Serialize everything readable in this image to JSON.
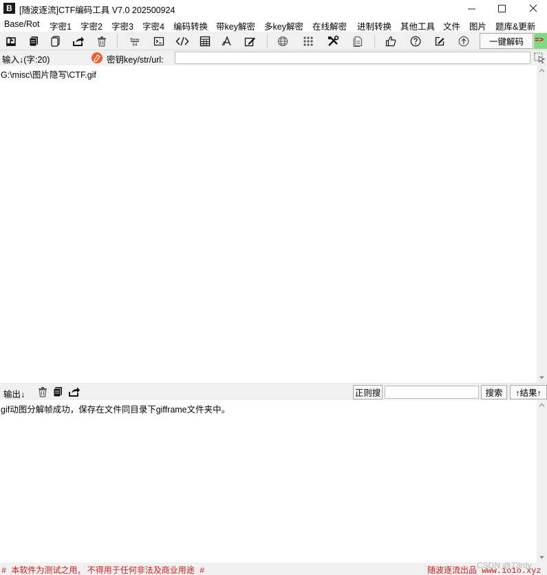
{
  "window": {
    "icon_text": "B",
    "title": "[随波逐流]CTF编码工具 V7.0  202500924"
  },
  "menu": [
    "Base/Rot",
    "字密1",
    "字密2",
    "字密3",
    "字密4",
    "编码转换",
    "带key解密",
    "多key解密",
    "在线解密",
    "进制转换",
    "其他工具",
    "文件",
    "图片",
    "题库&更新"
  ],
  "toolbar": {
    "icons": [
      "import-icon",
      "copy-icon",
      "paste-icon",
      "share-icon",
      "trash-icon",
      "base64-icon",
      "terminal-icon",
      "code-icon",
      "calculator-icon",
      "font-icon",
      "edit-frame-icon",
      "globe-icon",
      "grid-icon",
      "tools-icon",
      "document-icon",
      "thumbs-up-icon",
      "help-icon",
      "note-icon",
      "upload-icon"
    ],
    "onekey_label": "一键解码",
    "green_tab_text": "=>"
  },
  "input": {
    "label": "输入↓(字:20)",
    "key_label": "密钥key/str/url:",
    "key_value": "",
    "text": "G:\\misc\\图片隐写\\CTF.gif"
  },
  "output": {
    "label": "输出↓",
    "regex_label": "正则搜",
    "search_value": "",
    "search_label": "搜索",
    "result_label": "↑结果↑",
    "text": "gif动图分解帧成功，保存在文件同目录下gifframe文件夹中。"
  },
  "status": {
    "left": "# 本软件为测试之用, 不得用于任何非法及商业用途 #",
    "right": "随波逐流出品 www.1o1o.xyz",
    "watermark": "CSDN @73rdy"
  }
}
